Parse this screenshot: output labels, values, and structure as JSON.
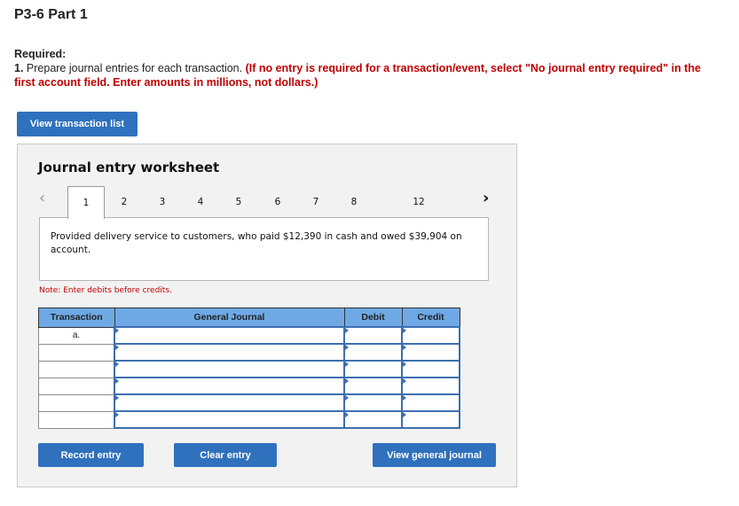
{
  "page": {
    "title": "P3-6 Part 1",
    "required_label": "Required:",
    "instruction_number": "1.",
    "instruction_text": " Prepare journal entries for each transaction. ",
    "instruction_note": "(If no entry is required for a transaction/event, select \"No journal entry required\" in the first account field. Enter amounts in millions, not dollars.)"
  },
  "buttons": {
    "view_transaction_list": "View transaction list",
    "record_entry": "Record entry",
    "clear_entry": "Clear entry",
    "view_general_journal": "View general journal"
  },
  "worksheet": {
    "title": "Journal entry worksheet",
    "prev_icon": "chevron-left-icon",
    "next_icon": "chevron-right-icon",
    "tabs": [
      "1",
      "2",
      "3",
      "4",
      "5",
      "6",
      "7",
      "8",
      "12"
    ],
    "active_tab": "1",
    "description": "Provided delivery service to customers, who paid $12,390 in cash and owed $39,904 on account.",
    "note": "Note: Enter debits before credits.",
    "table": {
      "headers": [
        "Transaction",
        "General Journal",
        "Debit",
        "Credit"
      ],
      "rows": [
        {
          "transaction": "a.",
          "account": "",
          "debit": "",
          "credit": ""
        },
        {
          "transaction": "",
          "account": "",
          "debit": "",
          "credit": ""
        },
        {
          "transaction": "",
          "account": "",
          "debit": "",
          "credit": ""
        },
        {
          "transaction": "",
          "account": "",
          "debit": "",
          "credit": ""
        },
        {
          "transaction": "",
          "account": "",
          "debit": "",
          "credit": ""
        },
        {
          "transaction": "",
          "account": "",
          "debit": "",
          "credit": ""
        }
      ]
    }
  },
  "colors": {
    "button_blue": "#2f71bd",
    "header_blue": "#6ea9e6",
    "note_red": "#c00000"
  }
}
